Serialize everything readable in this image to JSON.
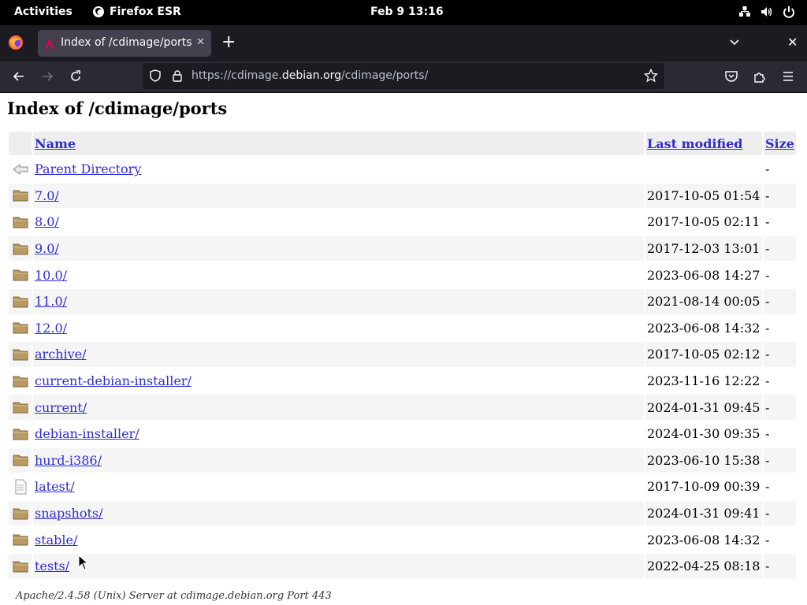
{
  "system_bar": {
    "activities": "Activities",
    "app_name": "Firefox ESR",
    "clock": "Feb 9  13:16"
  },
  "browser": {
    "tab_title": "Index of /cdimage/ports",
    "url_prefix": "https://cdimage.",
    "url_domain": "debian.org",
    "url_path": "/cdimage/ports/"
  },
  "page": {
    "title": "Index of /cdimage/ports",
    "columns": {
      "name": "Name",
      "last_modified": "Last modified",
      "size": "Size"
    },
    "rows": [
      {
        "icon": "back-icon",
        "name": "Parent Directory",
        "modified": "",
        "size": "-"
      },
      {
        "icon": "folder-icon",
        "name": "7.0/",
        "modified": "2017-10-05 01:54",
        "size": "-"
      },
      {
        "icon": "folder-icon",
        "name": "8.0/",
        "modified": "2017-10-05 02:11",
        "size": "-"
      },
      {
        "icon": "folder-icon",
        "name": "9.0/",
        "modified": "2017-12-03 13:01",
        "size": "-"
      },
      {
        "icon": "folder-icon",
        "name": "10.0/",
        "modified": "2023-06-08 14:27",
        "size": "-"
      },
      {
        "icon": "folder-icon",
        "name": "11.0/",
        "modified": "2021-08-14 00:05",
        "size": "-"
      },
      {
        "icon": "folder-icon",
        "name": "12.0/",
        "modified": "2023-06-08 14:32",
        "size": "-"
      },
      {
        "icon": "folder-icon",
        "name": "archive/",
        "modified": "2017-10-05 02:12",
        "size": "-"
      },
      {
        "icon": "folder-icon",
        "name": "current-debian-installer/",
        "modified": "2023-11-16 12:22",
        "size": "-"
      },
      {
        "icon": "folder-icon",
        "name": "current/",
        "modified": "2024-01-31 09:45",
        "size": "-"
      },
      {
        "icon": "folder-icon",
        "name": "debian-installer/",
        "modified": "2024-01-30 09:35",
        "size": "-"
      },
      {
        "icon": "folder-icon",
        "name": "hurd-i386/",
        "modified": "2023-06-10 15:38",
        "size": "-"
      },
      {
        "icon": "file-icon",
        "name": "latest/",
        "modified": "2017-10-09 00:39",
        "size": "-"
      },
      {
        "icon": "folder-icon",
        "name": "snapshots/",
        "modified": "2024-01-31 09:41",
        "size": "-"
      },
      {
        "icon": "folder-icon",
        "name": "stable/",
        "modified": "2023-06-08 14:32",
        "size": "-"
      },
      {
        "icon": "folder-icon",
        "name": "tests/",
        "modified": "2022-04-25 08:18",
        "size": "-"
      }
    ],
    "footer": "Apache/2.4.58 (Unix) Server at cdimage.debian.org Port 443"
  },
  "colors": {
    "link": "#2e2ed0",
    "row_alt": "#f5f5f5",
    "header_bg": "#eeeeee",
    "folder": "#b89a62"
  }
}
